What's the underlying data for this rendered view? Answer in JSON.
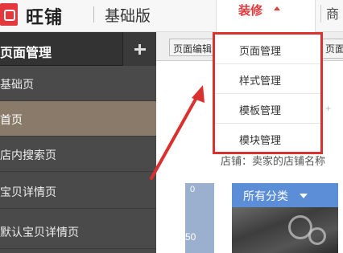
{
  "header": {
    "brand": "旺铺",
    "edition": "基础版",
    "decorate_menu_label": "装修",
    "next_tab_label": "商"
  },
  "sidebar": {
    "title": "页面管理",
    "items": [
      {
        "label": "基础页",
        "active": false
      },
      {
        "label": "首页",
        "active": true
      },
      {
        "label": "店内搜索页",
        "active": false
      },
      {
        "label": "宝贝详情页",
        "active": false
      },
      {
        "label": "默认宝贝详情页",
        "active": false
      }
    ]
  },
  "main": {
    "page_edit_tab": "页面编辑",
    "right_tab": "页面",
    "shop_name_text": "店铺：卖家的店铺名称",
    "ruler_0": "0",
    "ruler_50": "50",
    "category_dropdown": "所有分类"
  },
  "dropdown": {
    "items": [
      "页面管理",
      "样式管理",
      "模板管理",
      "模块管理"
    ]
  },
  "colors": {
    "accent_red": "#d9312f",
    "sidebar_bg": "#4a4a4a",
    "active_item": "#8a7a6a",
    "category_blue": "#5b8ed6"
  }
}
